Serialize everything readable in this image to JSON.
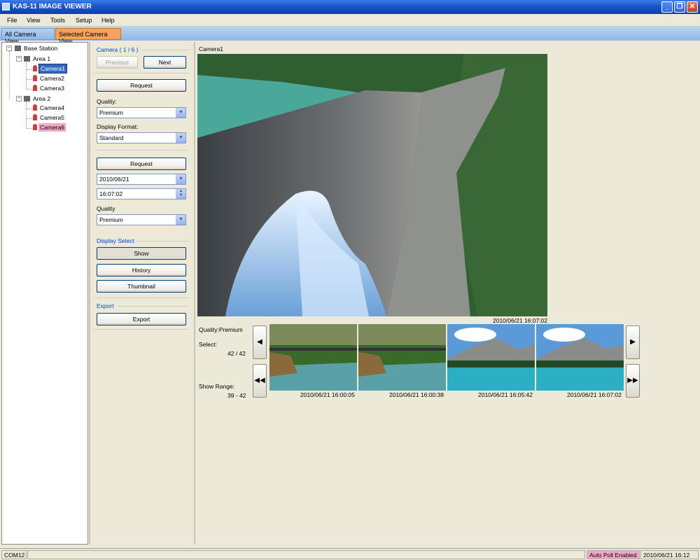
{
  "window": {
    "title": "KAS-11 IMAGE VIEWER"
  },
  "menu": [
    "File",
    "View",
    "Tools",
    "Setup",
    "Help"
  ],
  "tabs": [
    "All Camera View",
    "Selected Camera View"
  ],
  "tree": {
    "root": "Base Station",
    "areas": [
      {
        "label": "Area 1",
        "cameras": [
          "Camera1",
          "Camera2",
          "Camera3"
        ]
      },
      {
        "label": "Area 2",
        "cameras": [
          "Camera4",
          "Camera5",
          "Camera6"
        ]
      }
    ]
  },
  "panel": {
    "camera_group": "Camera ( 1 / 6 )",
    "previous": "Previous",
    "next": "Next",
    "request": "Request",
    "quality_label": "Quality:",
    "quality_value": "Premium",
    "format_label": "Display Format:",
    "format_value": "Standard",
    "request2": "Request",
    "date_value": "2010/06/21",
    "time_value": "16:07:02",
    "quality2_label": "Quality",
    "quality2_value": "Premium",
    "display_group": "Display Select",
    "show": "Show",
    "history": "History",
    "thumbnail": "Thumbnail",
    "export_group": "Export",
    "export": "Export"
  },
  "main": {
    "camera_label": "Camera1",
    "main_timestamp": "2010/06/21 16:07:02",
    "quality_info": "Quality:Premium",
    "select_label": "Select:",
    "select_value": "42 / 42",
    "range_label": "Show Range:",
    "range_value": "39 - 42",
    "thumbs": [
      {
        "timestamp": "2010/06/21 16:00:05"
      },
      {
        "timestamp": "2010/06/21 16:00:38"
      },
      {
        "timestamp": "2010/06/21 16:05:42"
      },
      {
        "timestamp": "2010/06/21 16:07:02"
      }
    ]
  },
  "status": {
    "port": "COM12",
    "auto_poll": "Auto Poll Enabled",
    "datetime": "2010/06/21 16:12"
  },
  "colors": {
    "selection": "#3169c6",
    "highlight": "#f4a8c8",
    "accent": "#0046d5",
    "active_tab": "#f6a35c"
  }
}
